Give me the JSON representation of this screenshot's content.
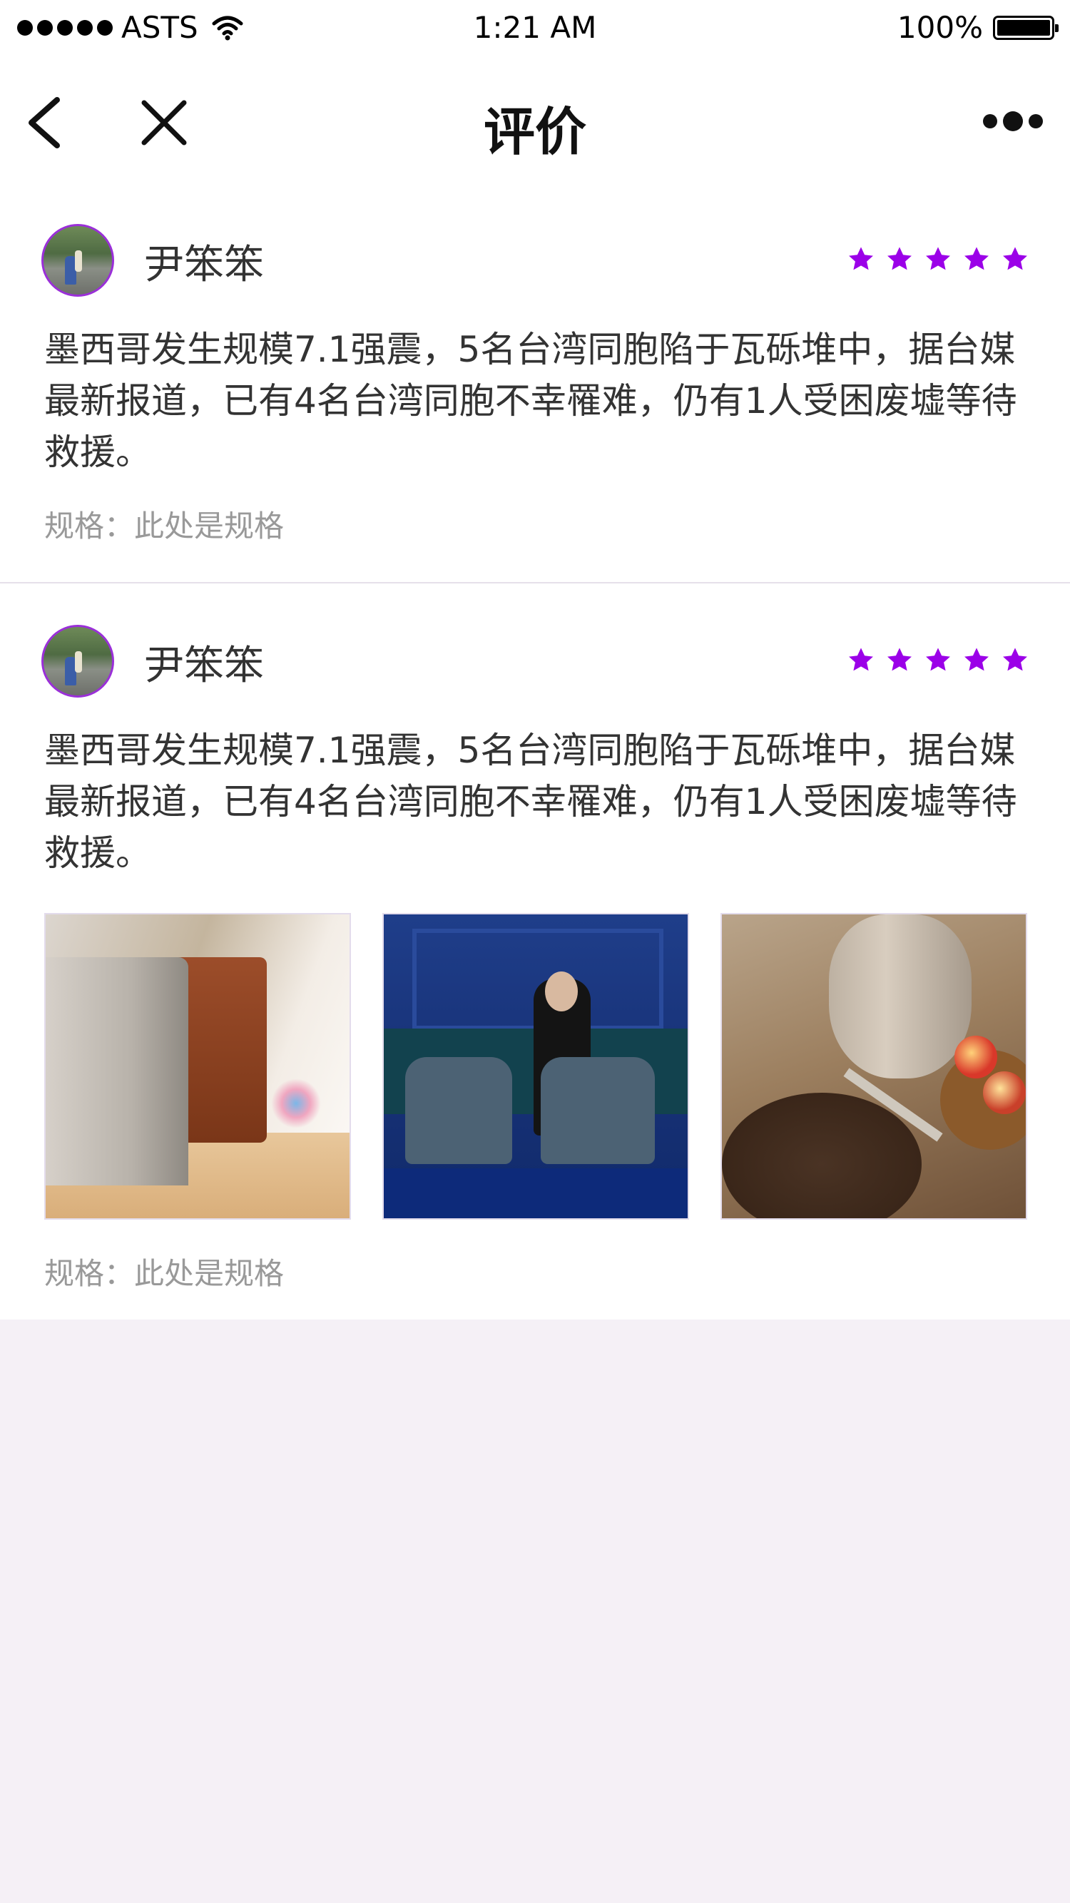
{
  "status_bar": {
    "carrier": "ASTS",
    "time": "1:21 AM",
    "battery_percent": "100%",
    "signal_icon": "signal-dots-icon",
    "wifi_icon": "wifi-icon",
    "battery_icon": "battery-icon"
  },
  "nav": {
    "title": "评价",
    "back_icon": "chevron-left-icon",
    "close_icon": "close-icon",
    "more_icon": "more-dots-icon"
  },
  "reviews": [
    {
      "username": "尹笨笨",
      "rating": 5,
      "rating_max": 5,
      "content": "墨西哥发生规模7.1强震，5名台湾同胞陷于瓦砾堆中，据台媒最新报道，已有4名台湾同胞不幸罹难，仍有1人受困废墟等待救援。",
      "spec": "规格：此处是规格"
    },
    {
      "username": "尹笨笨",
      "rating": 5,
      "rating_max": 5,
      "content": "墨西哥发生规模7.1强震，5名台湾同胞陷于瓦砾堆中，据台媒最新报道，已有4名台湾同胞不幸罹难，仍有1人受困废墟等待救援。",
      "spec": "规格：此处是规格",
      "photos": [
        "laptop-and-bag-photo",
        "man-with-laptop-photo",
        "jug-and-apples-photo"
      ]
    }
  ],
  "colors": {
    "accent": "#9b00e8",
    "background": "#f5f0f6",
    "text": "#333333",
    "muted": "#999999"
  }
}
